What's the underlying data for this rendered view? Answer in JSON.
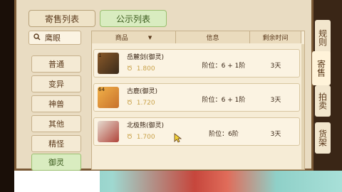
{
  "tabs": {
    "sale_list": "寄售列表",
    "public_list": "公示列表"
  },
  "side_tabs": [
    "规则",
    "寄售",
    "拍卖",
    "货架"
  ],
  "filter": {
    "header": "鹰眼",
    "items": [
      "普通",
      "变异",
      "神兽",
      "其他",
      "精怪",
      "御灵"
    ],
    "active": "御灵"
  },
  "table": {
    "headers": {
      "goods": "商品",
      "info": "信息",
      "time": "剩余时间"
    },
    "rows": [
      {
        "level": "1",
        "name": "岳麓剑(御灵)",
        "price": "1.800",
        "info": "阶位：6 + 1阶",
        "time": "3天"
      },
      {
        "level": "64",
        "name": "古鹿(御灵)",
        "price": "1.720",
        "info": "阶位：6 + 1阶",
        "time": "3天"
      },
      {
        "level": "",
        "name": "北极熊(御灵)",
        "price": "1.700",
        "info": "阶位：6阶",
        "time": "3天"
      }
    ]
  },
  "colors": {
    "accent_green": "#d9ecc0",
    "panel_bg": "#e9dcc2",
    "price_gold": "#c9a24a"
  }
}
